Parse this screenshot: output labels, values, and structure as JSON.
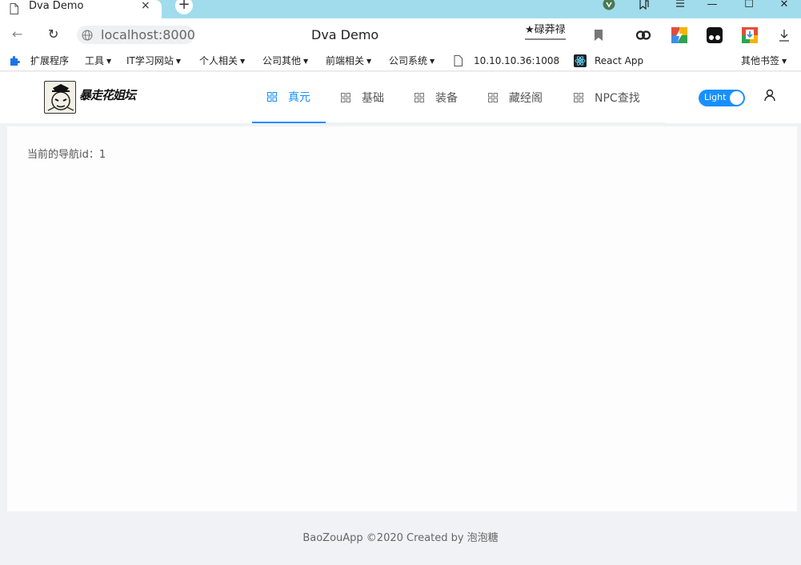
{
  "browser": {
    "tab_title": "Dva Demo",
    "tab_close": "×",
    "new_tab": "+",
    "window_controls": [
      "—",
      "☐",
      "✕"
    ],
    "address": "localhost:8000",
    "page_title": "Dva Demo",
    "extension_label": "★碌莽禄",
    "nav": {
      "back": "←",
      "reload": "↻"
    }
  },
  "bookmarks": {
    "items": [
      {
        "label": "扩展程序"
      },
      {
        "label": "工具"
      },
      {
        "label": "IT学习网站"
      },
      {
        "label": "个人相关"
      },
      {
        "label": "公司其他"
      },
      {
        "label": "前端相关"
      },
      {
        "label": "公司系统"
      },
      {
        "label": "10.10.10.36:1008"
      },
      {
        "label": "React App"
      }
    ],
    "other": "其他书签"
  },
  "app": {
    "logo_text": "暴走花姐坛",
    "menu": [
      {
        "label": "真元",
        "active": true
      },
      {
        "label": "基础",
        "active": false
      },
      {
        "label": "装备",
        "active": false
      },
      {
        "label": "藏经阁",
        "active": false
      },
      {
        "label": "NPC查找",
        "active": false
      }
    ],
    "theme_toggle": "Light",
    "accent_color": "#1890ff"
  },
  "content": {
    "text": "当前的导航id：1"
  },
  "footer": {
    "text": "BaoZouApp ©2020 Created by 泡泡糖"
  }
}
